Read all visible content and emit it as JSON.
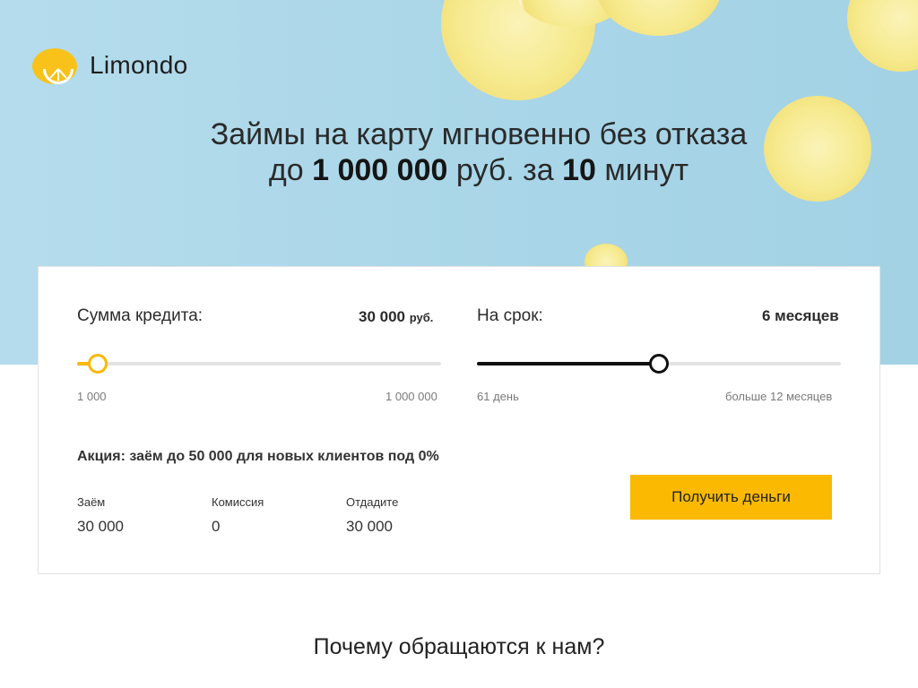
{
  "brand": {
    "name": "Limondo",
    "accent": "#fbb901"
  },
  "hero": {
    "line1": "Займы на карту мгновенно без отказа",
    "line2_prefix": "до",
    "line2_amount": "1 000 000",
    "line2_mid": "руб. за",
    "line2_minutes": "10",
    "line2_suffix": "минут"
  },
  "calculator": {
    "amount": {
      "label": "Сумма кредита:",
      "value": "30 000",
      "unit": "руб.",
      "min": "1 000",
      "max": "1 000 000",
      "position": 0.03
    },
    "term": {
      "label": "На срок:",
      "value": "6 месяцев",
      "min": "61 день",
      "max": "больше 12 месяцев",
      "position": 0.5
    },
    "promo": "Акция: заём до 50 000 для новых клиентов под 0%",
    "summary": [
      {
        "label": "Заём",
        "value": "30 000"
      },
      {
        "label": "Комиссия",
        "value": "0"
      },
      {
        "label": "Отдадите",
        "value": "30 000"
      }
    ],
    "cta": "Получить деньги"
  },
  "section": {
    "why_title": "Почему обращаются к нам?"
  }
}
